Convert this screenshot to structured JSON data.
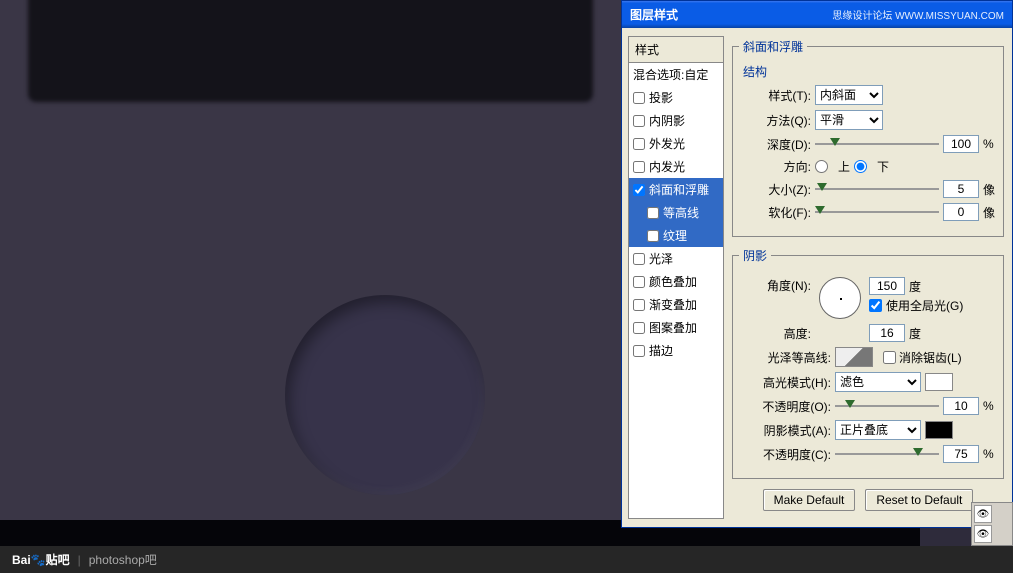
{
  "dialog": {
    "title": "图层样式",
    "watermark": "思缘设计论坛 WWW.MISSYUAN.COM"
  },
  "styles": {
    "header": "样式",
    "blend": "混合选项:自定",
    "items": [
      {
        "label": "投影",
        "checked": false
      },
      {
        "label": "内阴影",
        "checked": false
      },
      {
        "label": "外发光",
        "checked": false
      },
      {
        "label": "内发光",
        "checked": false
      },
      {
        "label": "斜面和浮雕",
        "checked": true,
        "selected": true
      },
      {
        "label": "等高线",
        "checked": false,
        "sub": true,
        "subsel": true
      },
      {
        "label": "纹理",
        "checked": false,
        "sub": true,
        "subsel": true
      },
      {
        "label": "光泽",
        "checked": false
      },
      {
        "label": "颜色叠加",
        "checked": false
      },
      {
        "label": "渐变叠加",
        "checked": false
      },
      {
        "label": "图案叠加",
        "checked": false
      },
      {
        "label": "描边",
        "checked": false
      }
    ]
  },
  "bevel": {
    "group_title": "斜面和浮雕",
    "structure_title": "结构",
    "style_label": "样式(T):",
    "style_value": "内斜面",
    "technique_label": "方法(Q):",
    "technique_value": "平滑",
    "depth_label": "深度(D):",
    "depth_value": "100",
    "depth_unit": "%",
    "direction_label": "方向:",
    "dir_up": "上",
    "dir_down": "下",
    "size_label": "大小(Z):",
    "size_value": "5",
    "size_unit": "像",
    "soften_label": "软化(F):",
    "soften_value": "0",
    "soften_unit": "像"
  },
  "shading": {
    "title": "阴影",
    "angle_label": "角度(N):",
    "angle_value": "150",
    "angle_unit": "度",
    "global_light": "使用全局光(G)",
    "altitude_label": "高度:",
    "altitude_value": "16",
    "altitude_unit": "度",
    "gloss_label": "光泽等高线:",
    "antialias": "消除锯齿(L)",
    "highlight_mode_label": "高光模式(H):",
    "highlight_mode_value": "滤色",
    "highlight_opacity_label": "不透明度(O):",
    "highlight_opacity_value": "10",
    "shadow_mode_label": "阴影模式(A):",
    "shadow_mode_value": "正片叠底",
    "shadow_opacity_label": "不透明度(C):",
    "shadow_opacity_value": "75",
    "pct": "%"
  },
  "buttons": {
    "default": "Make Default",
    "reset": "Reset to Default"
  },
  "footer": {
    "logo": "Bai🐾贴吧",
    "community": "photoshop吧"
  }
}
